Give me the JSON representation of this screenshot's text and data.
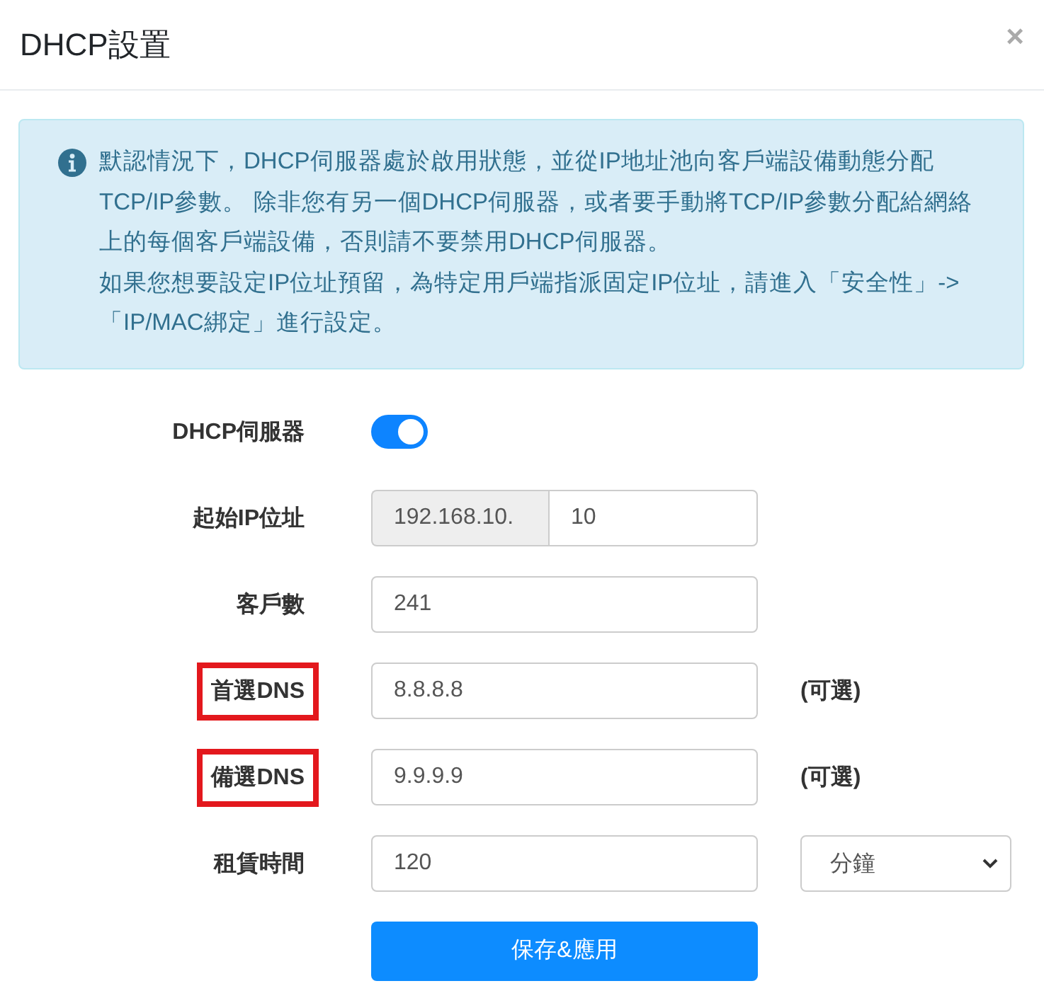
{
  "dialog": {
    "title": "DHCP設置",
    "close": "×"
  },
  "alert": {
    "paragraphs": [
      "默認情況下，DHCP伺服器處於啟用狀態，並從IP地址池向客戶端設備動態分配TCP/IP參數。 除非您有另一個DHCP伺服器，或者要手動將TCP/IP參數分配給網絡上的每個客戶端設備，否則請不要禁用DHCP伺服器。",
      "如果您想要設定IP位址預留，為特定用戶端指派固定IP位址，請進入「安全性」->「IP/MAC綁定」進行設定。"
    ]
  },
  "form": {
    "rows": [
      {
        "kind": "toggle",
        "label": "DHCP伺服器",
        "on": true,
        "highlighted": false
      },
      {
        "kind": "prefixed",
        "label": "起始IP位址",
        "prefix": "192.168.10.",
        "value": "10",
        "highlighted": false
      },
      {
        "kind": "input",
        "label": "客戶數",
        "value": "241",
        "highlighted": false
      },
      {
        "kind": "input",
        "label": "首選DNS",
        "value": "8.8.8.8",
        "note": "(可選)",
        "highlighted": true
      },
      {
        "kind": "input",
        "label": "備選DNS",
        "value": "9.9.9.9",
        "note": "(可選)",
        "highlighted": true
      },
      {
        "kind": "select",
        "label": "租賃時間",
        "value": "120",
        "option": "分鐘",
        "highlighted": false
      }
    ],
    "submit": "保存&應用"
  }
}
